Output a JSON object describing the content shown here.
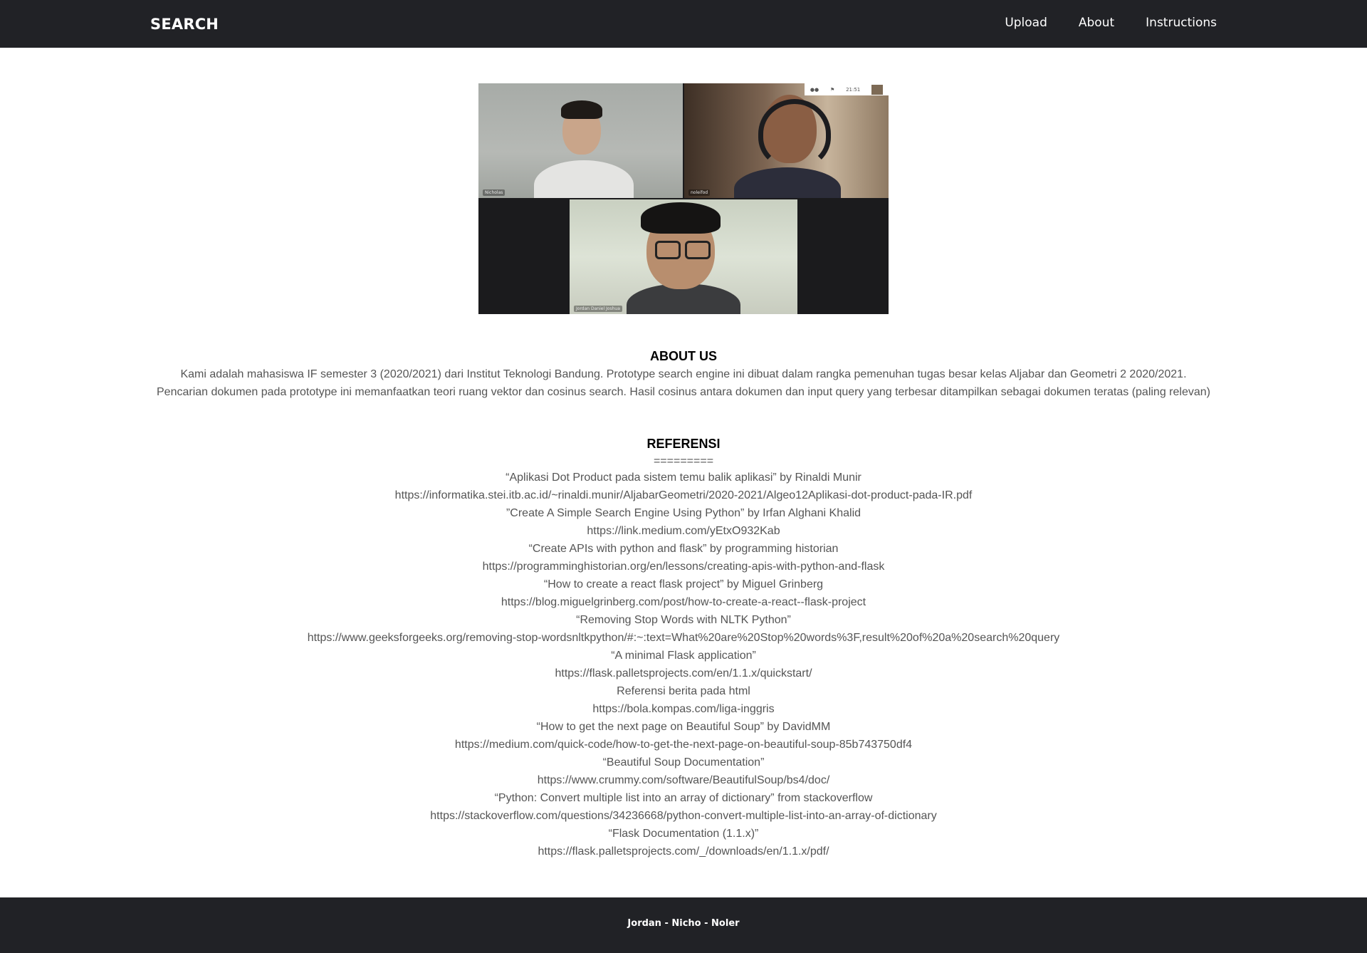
{
  "navbar": {
    "brand": "SEARCH",
    "links": [
      {
        "label": "Upload"
      },
      {
        "label": "About"
      },
      {
        "label": "Instructions"
      }
    ]
  },
  "photo": {
    "toolbar_time": "21:51",
    "tiles": [
      {
        "label": "Nicholas"
      },
      {
        "label": "noleifod"
      },
      {
        "label": "Jordan Daniel Joshua"
      }
    ]
  },
  "about": {
    "title": "ABOUT US",
    "line1": "Kami adalah mahasiswa IF semester 3 (2020/2021) dari Institut Teknologi Bandung. Prototype search engine ini dibuat dalam rangka pemenuhan tugas besar kelas Aljabar dan Geometri 2 2020/2021.",
    "line2": "Pencarian dokumen pada prototype ini memanfaatkan teori ruang vektor dan cosinus search. Hasil cosinus antara dokumen dan input query yang terbesar ditampilkan sebagai dokumen teratas (paling relevan)"
  },
  "references": {
    "title": "REFERENSI",
    "divider": "=========",
    "items": [
      "“Aplikasi Dot Product pada sistem temu balik aplikasi” by Rinaldi Munir",
      "https://informatika.stei.itb.ac.id/~rinaldi.munir/AljabarGeometri/2020-2021/Algeo12Aplikasi-dot-product-pada-IR.pdf",
      "”Create A Simple Search Engine Using Python” by Irfan Alghani Khalid",
      "https://link.medium.com/yEtxO932Kab",
      "“Create APIs with python and flask” by programming historian",
      "https://programminghistorian.org/en/lessons/creating-apis-with-python-and-flask",
      "“How to create a react flask project” by Miguel Grinberg",
      "https://blog.miguelgrinberg.com/post/how-to-create-a-react--flask-project",
      "“Removing Stop Words with NLTK Python”",
      "https://www.geeksforgeeks.org/removing-stop-wordsnltkpython/#:~:text=What%20are%20Stop%20words%3F,result%20of%20a%20search%20query",
      "“A minimal Flask application”",
      "https://flask.palletsprojects.com/en/1.1.x/quickstart/",
      "Referensi berita pada html",
      "https://bola.kompas.com/liga-inggris",
      "“How to get the next page on Beautiful Soup” by DavidMM",
      "https://medium.com/quick-code/how-to-get-the-next-page-on-beautiful-soup-85b743750df4",
      "“Beautiful Soup Documentation”",
      "https://www.crummy.com/software/BeautifulSoup/bs4/doc/",
      "“Python: Convert multiple list into an array of dictionary” from stackoverflow",
      "https://stackoverflow.com/questions/34236668/python-convert-multiple-list-into-an-array-of-dictionary",
      "“Flask Documentation (1.1.x)”",
      "https://flask.palletsprojects.com/_/downloads/en/1.1.x/pdf/"
    ]
  },
  "footer": {
    "text": "Jordan - Nicho - Noler"
  },
  "colors": {
    "navbar_bg": "#212226",
    "text_gray": "#555555",
    "heading": "#000000"
  }
}
